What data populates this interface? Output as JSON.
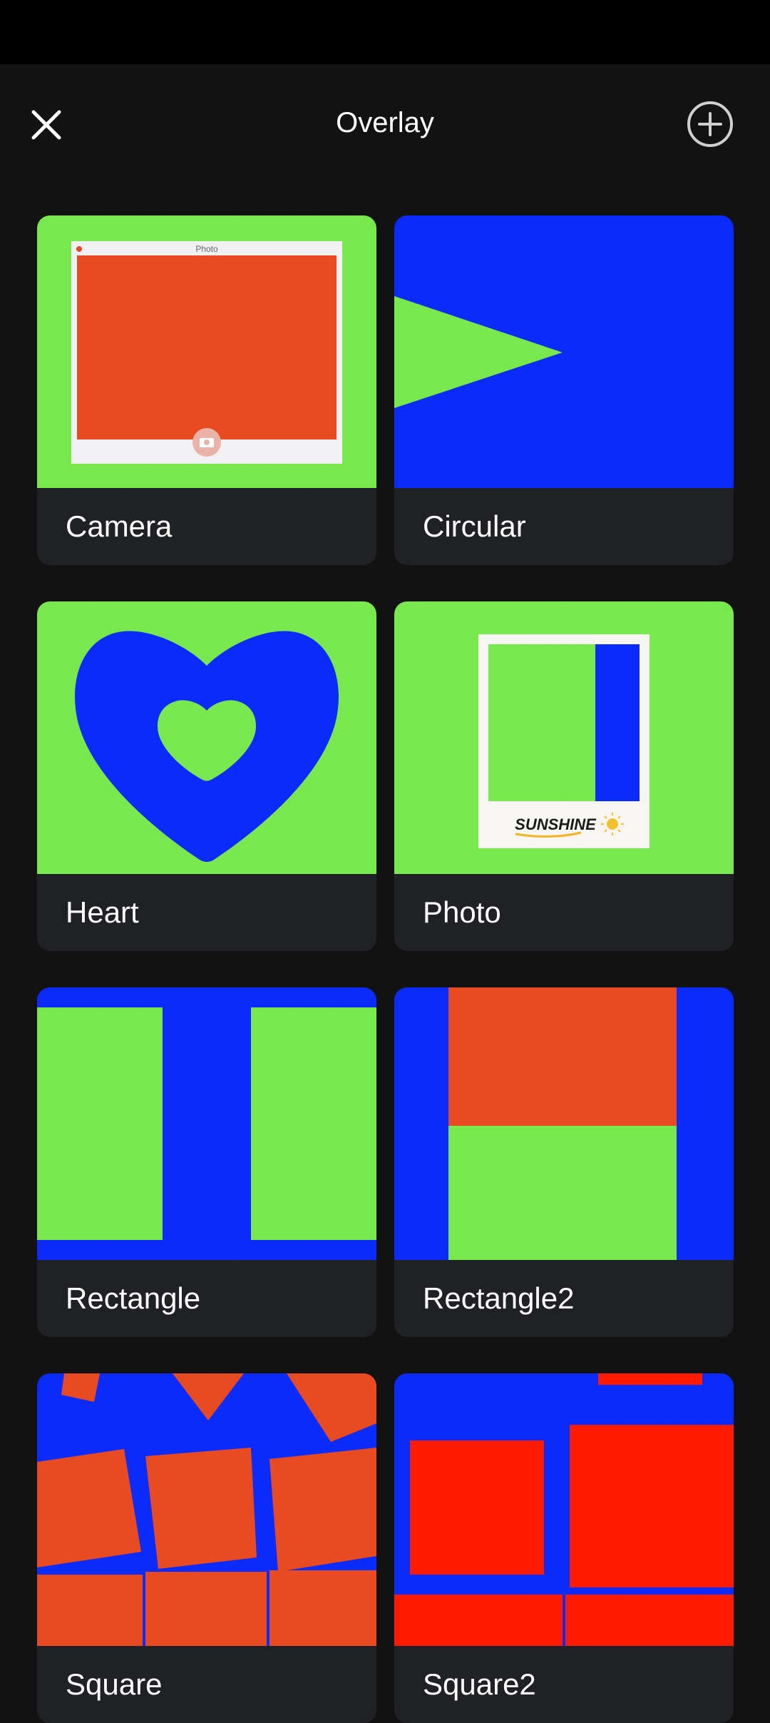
{
  "header": {
    "title": "Overlay",
    "close_icon": "close-icon",
    "add_icon": "plus-circle-icon"
  },
  "thumbnail_text": {
    "camera_caption": "Photo",
    "photo_caption": "SUNSHINE"
  },
  "overlays": [
    {
      "label": "Camera"
    },
    {
      "label": "Circular"
    },
    {
      "label": "Heart"
    },
    {
      "label": "Photo"
    },
    {
      "label": "Rectangle"
    },
    {
      "label": "Rectangle2"
    },
    {
      "label": "Square"
    },
    {
      "label": "Square2"
    }
  ],
  "colors": {
    "background": "#121212",
    "card": "#202124",
    "green": "#79E74E",
    "blue": "#0B2BFB",
    "orange": "#E84A22",
    "red": "#FF1A00"
  }
}
